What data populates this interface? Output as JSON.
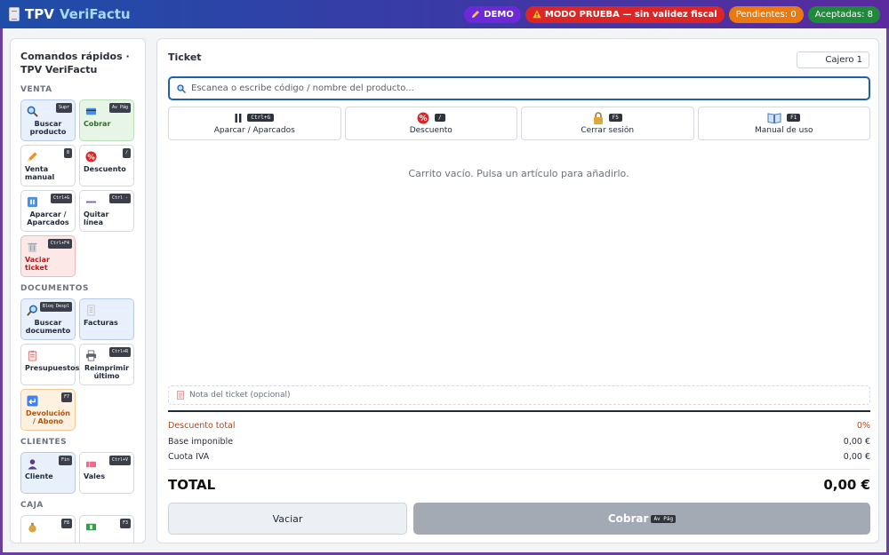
{
  "app": {
    "title_part1": "TPV",
    "title_part2": "VeriFactu"
  },
  "badges": {
    "demo": "DEMO",
    "prueba": "MODO PRUEBA — sin validez fiscal",
    "pendientes": "Pendientes: 0",
    "aceptadas": "Aceptadas: 8"
  },
  "sidebar": {
    "title": "Comandos rápidos · TPV VeriFactu",
    "sections": {
      "venta": "VENTA",
      "documentos": "DOCUMENTOS",
      "clientes": "CLIENTES",
      "caja": "CAJA"
    },
    "venta": [
      {
        "label": "Buscar producto",
        "kbd": "Supr"
      },
      {
        "label": "Cobrar",
        "kbd": "Av Pág"
      },
      {
        "label": "Venta manual",
        "kbd": "8"
      },
      {
        "label": "Descuento",
        "kbd": "/"
      },
      {
        "label": "Aparcar / Aparcados",
        "kbd": "Ctrl+G"
      },
      {
        "label": "Quitar línea",
        "kbd": "Ctrl -"
      },
      {
        "label": "Vaciar ticket",
        "kbd": "Ctrl+F4"
      }
    ],
    "documentos": [
      {
        "label": "Buscar documento",
        "kbd": "Bloq Despl"
      },
      {
        "label": "Facturas",
        "kbd": ""
      },
      {
        "label": "Presupuestos",
        "kbd": ""
      },
      {
        "label": "Reimprimir último",
        "kbd": "Ctrl+R"
      },
      {
        "label": "Devolución / Abono",
        "kbd": "F7"
      }
    ],
    "clientes": [
      {
        "label": "Cliente",
        "kbd": "Fin"
      },
      {
        "label": "Vales",
        "kbd": "Ctrl+V"
      }
    ],
    "caja": [
      {
        "label": "",
        "kbd": "F8"
      },
      {
        "label": "",
        "kbd": "F3"
      }
    ]
  },
  "ticket": {
    "title": "Ticket",
    "cashier": "Cajero 1",
    "search_placeholder": "Escanea o escribe código / nombre del producto...",
    "actions": [
      {
        "label": "Aparcar / Aparcados",
        "kbd": "Ctrl+G"
      },
      {
        "label": "Descuento",
        "kbd": "/"
      },
      {
        "label": "Cerrar sesión",
        "kbd": "F5"
      },
      {
        "label": "Manual de uso",
        "kbd": "F1"
      }
    ],
    "empty_message": "Carrito vacío. Pulsa un artículo para añadirlo.",
    "note_placeholder": "Nota del ticket (opcional)",
    "totals": {
      "discount_label": "Descuento total",
      "discount_value": "0%",
      "base_label": "Base imponible",
      "base_value": "0,00 €",
      "iva_label": "Cuota IVA",
      "iva_value": "0,00 €",
      "total_label": "TOTAL",
      "total_value": "0,00 €"
    },
    "buttons": {
      "clear": "Vaciar",
      "pay": "Cobrar",
      "pay_kbd": "Av Pág"
    }
  },
  "colors": {
    "accent": "#1e5fb0",
    "demo": "#6d28d9",
    "prueba": "#dc2626",
    "pendientes": "#ea7a10",
    "aceptadas": "#1e8a3a"
  }
}
